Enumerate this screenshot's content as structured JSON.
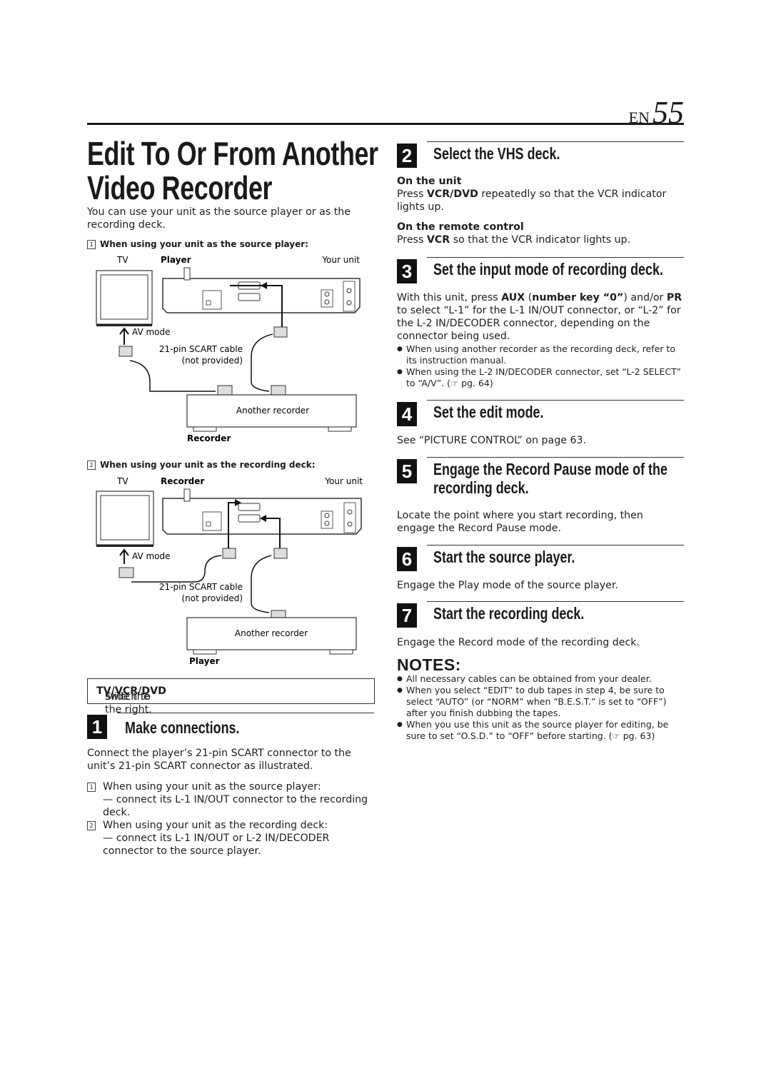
{
  "header": {
    "lang": "EN",
    "page_number": "55"
  },
  "title": {
    "line1": "Edit To Or From Another",
    "line2": "Video Recorder"
  },
  "intro": "You can use your unit as the source player or as the recording deck.",
  "diagram1": {
    "number": "1",
    "caption": "When using your unit as the source player:",
    "tv_label": "TV",
    "unit_role": "Player",
    "unit_label": "Your unit",
    "av_mode": "AV mode",
    "cable_line1": "21-pin SCART cable",
    "cable_line2": "(not provided)",
    "other_label": "Another recorder",
    "other_role": "Recorder"
  },
  "diagram2": {
    "number": "2",
    "caption": "When using your unit as the recording deck:",
    "tv_label": "TV",
    "unit_role": "Recorder",
    "unit_label": "Your unit",
    "av_mode": "AV mode",
    "cable_line1": "21-pin SCART cable",
    "cable_line2": "(not provided)",
    "other_label": "Another recorder",
    "other_role": "Player"
  },
  "instruction_box": {
    "pre": "Slide the ",
    "bold": "TV/VCR/DVD",
    "post": " switch to the right."
  },
  "steps": [
    {
      "number": "1",
      "heading": "Make connections.",
      "body": "Connect the player’s 21-pin SCART connector to the unit’s 21-pin SCART connector as illustrated.",
      "items": [
        {
          "num": "1",
          "line1": "When using your unit as the source player:",
          "line2": "— connect its L-1 IN/OUT connector to the recording deck."
        },
        {
          "num": "2",
          "line1": "When using your unit as the recording deck:",
          "line2": "— connect its L-1 IN/OUT or L-2 IN/DECODER connector to the source player."
        }
      ]
    },
    {
      "number": "2",
      "heading": "Select the VHS deck.",
      "sub1_title": "On the unit",
      "sub1_pre": "Press ",
      "sub1_bold": "VCR/DVD",
      "sub1_post": " repeatedly so that the VCR indicator lights up.",
      "sub2_title": "On the remote control",
      "sub2_pre": "Press ",
      "sub2_bold": "VCR",
      "sub2_post": " so that the VCR indicator lights up."
    },
    {
      "number": "3",
      "heading": "Set the input mode of recording deck.",
      "body_pre": "With this unit, press ",
      "body_b1": "AUX",
      "body_m1": " (",
      "body_b2": "number key “0”",
      "body_m2": ") and/or ",
      "body_b3": "PR",
      "body_post": " to select “L-1” for the L-1 IN/OUT connector, or “L-2” for the L-2 IN/DECODER connector, depending on the connector being used.",
      "bullets": [
        "When using another recorder as the recording deck, refer to its instruction manual.",
        "When using the L-2 IN/DECODER connector, set “L-2 SELECT” to “A/V”. (☞ pg. 64)"
      ]
    },
    {
      "number": "4",
      "heading": "Set the edit mode.",
      "body": "See “PICTURE CONTROL” on page 63."
    },
    {
      "number": "5",
      "heading_line1": "Engage the Record Pause mode of the",
      "heading_line2": "recording deck.",
      "body": "Locate the point where you start recording, then engage the Record Pause mode."
    },
    {
      "number": "6",
      "heading": "Start the source player.",
      "body": "Engage the Play mode of the source player."
    },
    {
      "number": "7",
      "heading": "Start the recording deck.",
      "body": "Engage the Record mode of the recording deck."
    }
  ],
  "notes": {
    "title": "NOTES:",
    "items": [
      "All necessary cables can be obtained from your dealer.",
      "When you select “EDIT” to dub tapes in step 4, be sure to select “AUTO” (or “NORM” when “B.E.S.T.” is set to “OFF”) after you finish dubbing the tapes.",
      "When you use this unit as the source player for editing, be sure to set “O.S.D.” to “OFF” before starting. (☞ pg. 63)"
    ]
  }
}
